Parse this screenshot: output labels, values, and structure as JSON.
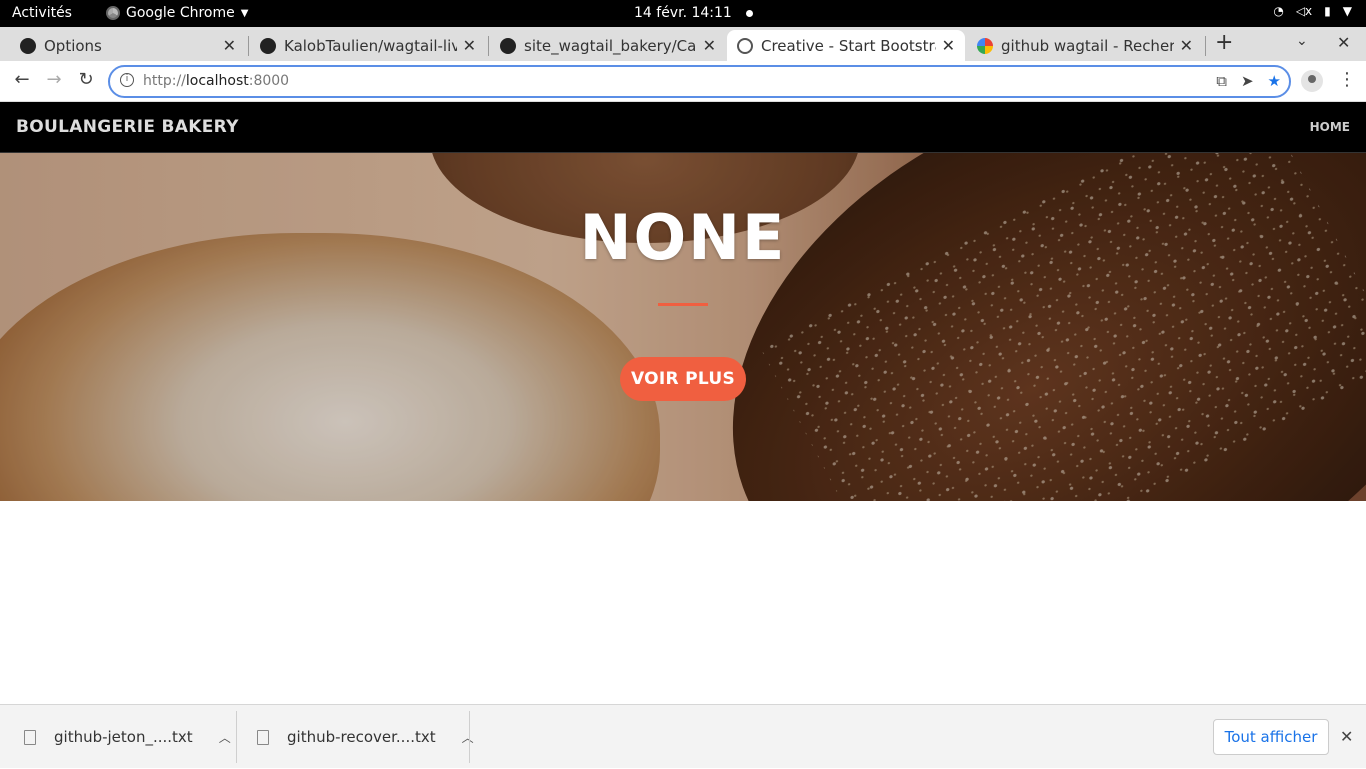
{
  "gnome": {
    "activities": "Activités",
    "app_name": "Google Chrome",
    "clock": "14 févr.  14:11"
  },
  "tabs": [
    {
      "label": "Options",
      "icon": "github-icon",
      "active": false
    },
    {
      "label": "KalobTaulien/wagtail-live",
      "icon": "github-icon",
      "active": false
    },
    {
      "label": "site_wagtail_bakery/Capt",
      "icon": "github-icon",
      "active": false
    },
    {
      "label": "Creative - Start Bootstrap",
      "icon": "globe-icon",
      "active": true
    },
    {
      "label": "github wagtail - Recherch",
      "icon": "google-icon",
      "active": false
    }
  ],
  "omnibox": {
    "url_prefix": "http://",
    "url_host": "localhost",
    "url_port": ":8000"
  },
  "site": {
    "brand": "BOULANGERIE BAKERY",
    "nav_home": "HOME",
    "hero_title": "NONE",
    "cta_label": "VOIR PLUS"
  },
  "downloads": {
    "items": [
      {
        "name": "github-jeton_....txt"
      },
      {
        "name": "github-recover....txt"
      }
    ],
    "show_all": "Tout afficher"
  },
  "colors": {
    "accent": "#f05f40",
    "omnibox_focus": "#5b8ee6",
    "link_blue": "#1a73e8"
  }
}
